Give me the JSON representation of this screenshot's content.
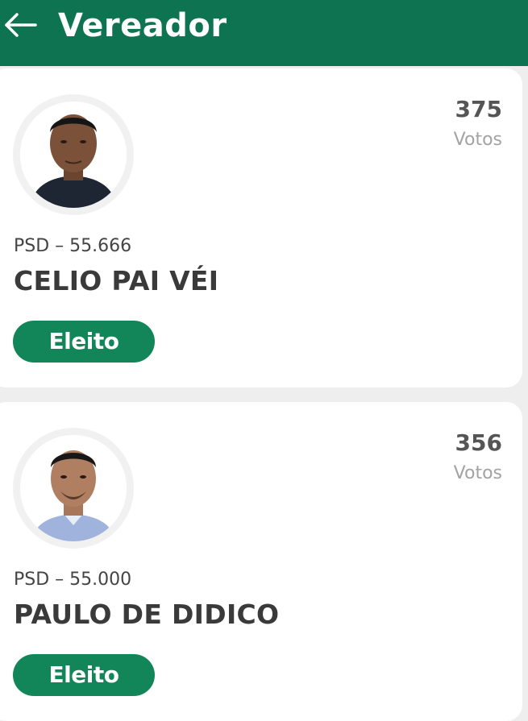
{
  "header": {
    "title": "Vereador",
    "back_icon": "arrow-left-icon"
  },
  "colors": {
    "header_bg": "#0e7350",
    "badge_bg": "#138659",
    "page_bg": "#eeeeee"
  },
  "candidates": [
    {
      "votes": "375",
      "votes_label": "Votos",
      "party_number": "PSD – 55.666",
      "name": "CELIO PAI VÉI",
      "status": "Eleito"
    },
    {
      "votes": "356",
      "votes_label": "Votos",
      "party_number": "PSD – 55.000",
      "name": "PAULO DE DIDICO",
      "status": "Eleito"
    }
  ]
}
